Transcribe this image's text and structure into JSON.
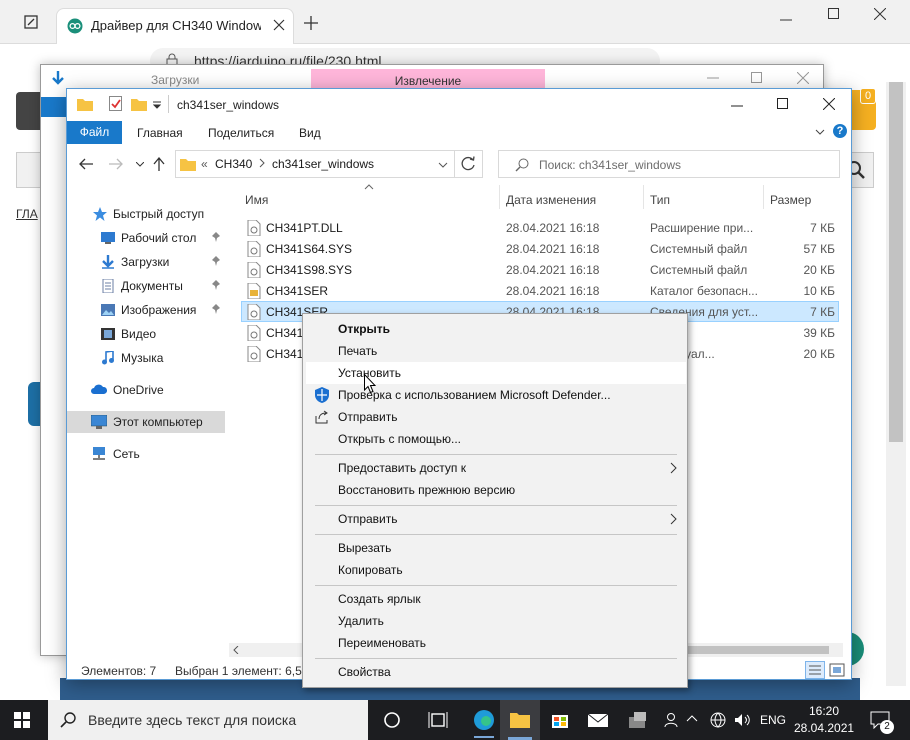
{
  "browser": {
    "tab_title": "Драйвер для CH340 Windows (X",
    "url": "https://iarduino.ru/file/230.html",
    "page_crumb": "ГЛА",
    "page_footer_text": "Эл",
    "cart_badge": "0"
  },
  "downloads_window": {
    "title": "Загрузки",
    "ribbon_label": "Извлечение"
  },
  "explorer": {
    "title": "ch341ser_windows",
    "ribbon_tabs": [
      "Файл",
      "Главная",
      "Поделиться",
      "Вид"
    ],
    "breadcrumb": [
      "CH340",
      "ch341ser_windows"
    ],
    "breadcrumb_more": "«",
    "search_placeholder": "Поиск: ch341ser_windows",
    "columns": {
      "name": "Имя",
      "date": "Дата изменения",
      "type": "Тип",
      "size": "Размер"
    },
    "nav": [
      {
        "label": "Быстрый доступ",
        "icon": "star-icon"
      },
      {
        "label": "Рабочий стол",
        "icon": "desktop-icon"
      },
      {
        "label": "Загрузки",
        "icon": "download-icon"
      },
      {
        "label": "Документы",
        "icon": "documents-icon"
      },
      {
        "label": "Изображения",
        "icon": "pictures-icon"
      },
      {
        "label": "Видео",
        "icon": "video-icon"
      },
      {
        "label": "Музыка",
        "icon": "music-icon"
      },
      {
        "label": "OneDrive",
        "icon": "cloud-icon"
      },
      {
        "label": "Этот компьютер",
        "icon": "computer-icon"
      },
      {
        "label": "Сеть",
        "icon": "network-icon"
      }
    ],
    "files": [
      {
        "name": "CH341PT.DLL",
        "date": "28.04.2021 16:18",
        "type": "Расширение при...",
        "size": "7 КБ"
      },
      {
        "name": "CH341S64.SYS",
        "date": "28.04.2021 16:18",
        "type": "Системный файл",
        "size": "57 КБ"
      },
      {
        "name": "CH341S98.SYS",
        "date": "28.04.2021 16:18",
        "type": "Системный файл",
        "size": "20 КБ"
      },
      {
        "name": "CH341SER",
        "date": "28.04.2021 16:18",
        "type": "Каталог безопасн...",
        "size": "10 КБ"
      },
      {
        "name": "CH341SER",
        "date": "28.04.2021 16:18",
        "type": "Сведения для уст...",
        "size": "7 КБ"
      },
      {
        "name": "CH341S",
        "date": "",
        "type": "файл",
        "size": "39 КБ"
      },
      {
        "name": "CH341S",
        "date": "",
        "type": "р виртуал...",
        "size": "20 КБ"
      }
    ],
    "status_count": "Элементов: 7",
    "status_selected": "Выбран 1 элемент: 6,52"
  },
  "context_menu": {
    "open": "Открыть",
    "print": "Печать",
    "install": "Установить",
    "defender": "Проверка с использованием Microsoft Defender...",
    "share": "Отправить",
    "open_with": "Открыть с помощью...",
    "give_access": "Предоставить доступ к",
    "restore": "Восстановить прежнюю версию",
    "send_to": "Отправить",
    "cut": "Вырезать",
    "copy": "Копировать",
    "shortcut": "Создать ярлык",
    "delete": "Удалить",
    "rename": "Переименовать",
    "properties": "Свойства"
  },
  "taskbar": {
    "search_placeholder": "Введите здесь текст для поиска",
    "lang": "ENG",
    "time": "16:20",
    "date": "28.04.2021",
    "notif_count": "2"
  },
  "colors": {
    "accent": "#1979ca",
    "selection": "#cce8ff",
    "taskbar": "#1c1d20"
  }
}
